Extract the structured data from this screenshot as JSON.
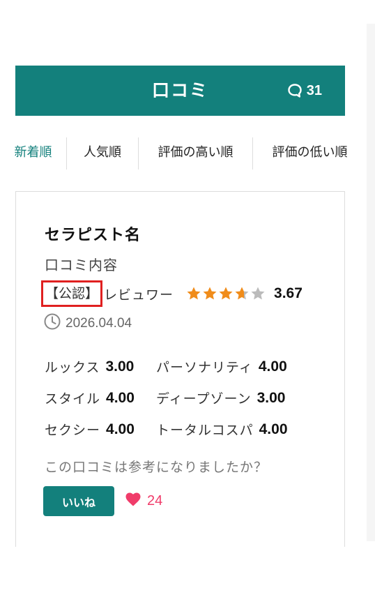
{
  "header": {
    "title": "口コミ",
    "count": "31",
    "icon": "comment-bubble-icon"
  },
  "tabs": [
    {
      "label": "新着順",
      "active": true
    },
    {
      "label": "人気順",
      "active": false
    },
    {
      "label": "評価の高い順",
      "active": false
    },
    {
      "label": "評価の低い順",
      "active": false
    }
  ],
  "review": {
    "therapist_name": "セラピスト名",
    "content": "口コミ内容",
    "badge": "【公認】",
    "reviewer_label": "レビュワー",
    "rating": "3.67",
    "rating_value": 3.67,
    "rating_max": 5,
    "date": "2026.04.04",
    "scores": [
      [
        {
          "label": "ルックス",
          "value": "3.00"
        },
        {
          "label": "パーソナリティ",
          "value": "4.00"
        }
      ],
      [
        {
          "label": "スタイル",
          "value": "4.00"
        },
        {
          "label": "ディープゾーン",
          "value": "3.00"
        }
      ],
      [
        {
          "label": "セクシー",
          "value": "4.00"
        },
        {
          "label": "トータルコスパ",
          "value": "4.00"
        }
      ]
    ],
    "question": "この口コミは参考になりましたか？",
    "like_label": "いいね",
    "like_count": "24"
  },
  "colors": {
    "accent": "#13807c",
    "star": "#f08c1a",
    "star_empty": "#bbbbbb",
    "heart": "#f03c6a",
    "badge_border": "#e02020"
  }
}
